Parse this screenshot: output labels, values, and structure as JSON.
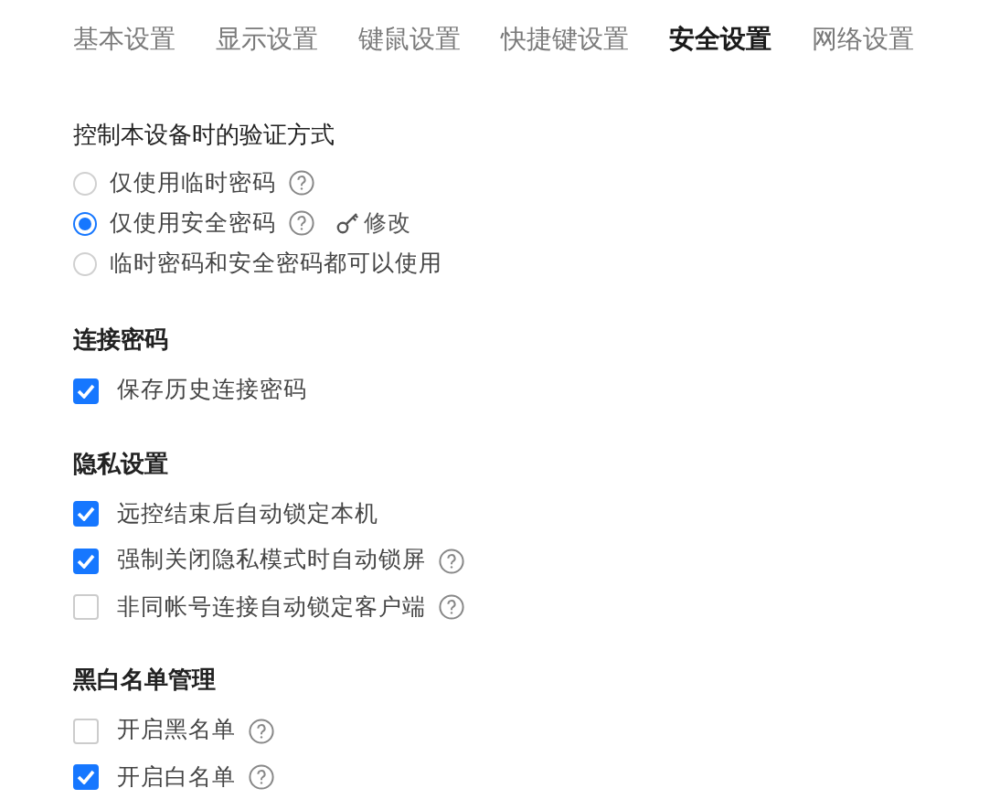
{
  "tabs": [
    {
      "label": "基本设置",
      "selected": false
    },
    {
      "label": "显示设置",
      "selected": false
    },
    {
      "label": "键鼠设置",
      "selected": false
    },
    {
      "label": "快捷键设置",
      "selected": false
    },
    {
      "label": "安全设置",
      "selected": true
    },
    {
      "label": "网络设置",
      "selected": false
    }
  ],
  "verification": {
    "title": "控制本设备时的验证方式",
    "options": [
      {
        "label": "仅使用临时密码",
        "selected": false,
        "help": true
      },
      {
        "label": "仅使用安全密码",
        "selected": true,
        "help": true,
        "edit_link": "修改"
      },
      {
        "label": "临时密码和安全密码都可以使用",
        "selected": false,
        "help": false
      }
    ]
  },
  "sections": [
    {
      "title": "连接密码",
      "items": [
        {
          "label": "保存历史连接密码",
          "checked": true,
          "help": false
        }
      ]
    },
    {
      "title": "隐私设置",
      "items": [
        {
          "label": "远控结束后自动锁定本机",
          "checked": true,
          "help": false
        },
        {
          "label": "强制关闭隐私模式时自动锁屏",
          "checked": true,
          "help": true
        },
        {
          "label": "非同帐号连接自动锁定客户端",
          "checked": false,
          "help": true
        }
      ]
    },
    {
      "title": "黑白名单管理",
      "items": [
        {
          "label": "开启黑名单",
          "checked": false,
          "help": true
        },
        {
          "label": "开启白名单",
          "checked": true,
          "help": true
        }
      ]
    }
  ]
}
